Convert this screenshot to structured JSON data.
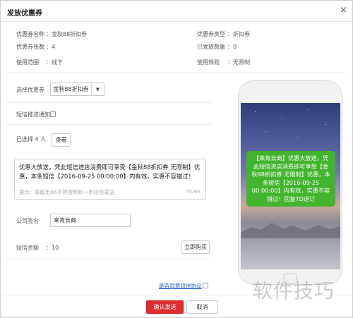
{
  "dialog": {
    "title": "发放优惠券",
    "close_glyph": "×"
  },
  "coupon_info": {
    "name_label": "优惠券名称",
    "name_value": "：金秋88折扣券",
    "type_label": "优惠券类型",
    "type_value": "：折扣券",
    "count_label": "优惠券张数",
    "count_value": "：4",
    "issued_label": "已发放数量",
    "issued_value": "：0",
    "scope_label": "使用范围",
    "scope_value": "：线下",
    "rule_label": "使用规则",
    "rule_value": "：无限制"
  },
  "form": {
    "select_coupon_label": "选择优惠券",
    "select_coupon_value": "金秋88折扣券",
    "sms_notify_label": "短信推送通知",
    "selected_label": "已选择 4 人",
    "view_button": "查看",
    "message_text": "优惠大放送，凭此短信进店消费即可享受【金秋88折扣券  无限制】优惠，本条短信【2016-09-25 00:00:00】内有效，实惠不容错过！",
    "message_hint": "提示：每超出66字将按照新一条短信发送",
    "message_count": "75/66",
    "company_sign_label": "公司签名",
    "company_sign_value": "来肯云商",
    "sms_balance_label": "短信余额",
    "sms_balance_value": "：10",
    "buy_button": "立即购买",
    "agreement_link": "是否同意短信协议",
    "confirm_button": "确认发送",
    "cancel_button": "取消"
  },
  "phone_preview": {
    "sms_text": "【来肯云商】优惠大放送，凭此短信进店消费即可享受【金秋88折扣券 无限制】优惠，本条短信【2016-09-25 00:00:00】内有效，实惠不容错过！回复TD退订"
  },
  "watermark": "软件技巧",
  "colors": {
    "primary_button": "#e02e2e",
    "sms_bubble": "#42b42e",
    "link": "#2255cc"
  }
}
